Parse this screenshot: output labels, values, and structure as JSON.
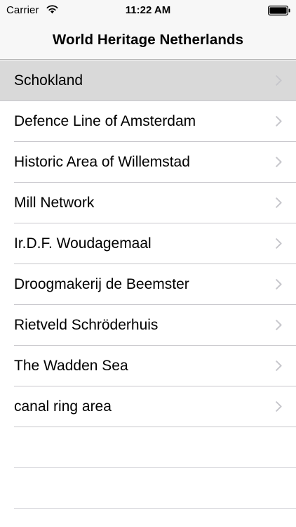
{
  "status_bar": {
    "carrier": "Carrier",
    "time": "11:22 AM",
    "wifi_icon": "wifi-icon",
    "battery_icon": "battery-icon"
  },
  "nav": {
    "title": "World Heritage Netherlands"
  },
  "list": {
    "selected_index": 0,
    "chevron_icon": "chevron-right-icon",
    "items": [
      {
        "label": "Schokland"
      },
      {
        "label": "Defence Line of Amsterdam"
      },
      {
        "label": "Historic Area of Willemstad"
      },
      {
        "label": "Mill Network"
      },
      {
        "label": "Ir.D.F. Woudagemaal"
      },
      {
        "label": "Droogmakerij de Beemster"
      },
      {
        "label": "Rietveld Schröderhuis"
      },
      {
        "label": "The Wadden Sea"
      },
      {
        "label": "canal ring area"
      }
    ]
  },
  "colors": {
    "bar_background": "#f7f7f7",
    "selected_row": "#d9d9d9",
    "separator": "#c8c7cc",
    "chevron": "#c7c7cc"
  }
}
